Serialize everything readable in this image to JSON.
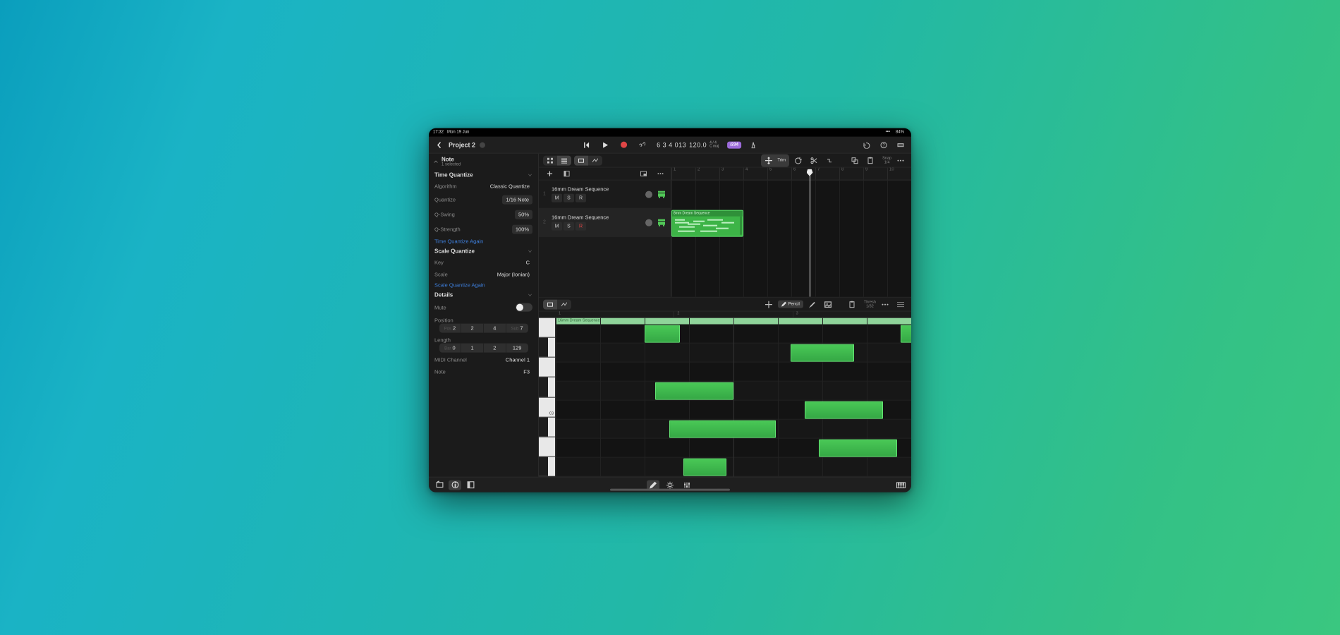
{
  "status": {
    "time": "17:32",
    "date": "Mon 19 Jun",
    "battery": "84%"
  },
  "nav": {
    "project_title": "Project 2",
    "lcd": {
      "position": "6 3 4 013",
      "tempo": "120.0",
      "sig": "4 / 4",
      "key": "C maj",
      "beat_badge": "/234"
    }
  },
  "inspector": {
    "header_title": "Note",
    "header_sub": "1 selected",
    "time_quantize_title": "Time Quantize",
    "algorithm_k": "Algorithm",
    "algorithm_v": "Classic Quantize",
    "quantize_k": "Quantize",
    "quantize_v": "1/16 Note",
    "qswing_k": "Q-Swing",
    "qswing_v": "50%",
    "qstrength_k": "Q-Strength",
    "qstrength_v": "100%",
    "tq_again": "Time Quantize Again",
    "scale_quantize_title": "Scale Quantize",
    "key_k": "Key",
    "key_v": "C",
    "scale_k": "Scale",
    "scale_v": "Major (Ionian)",
    "sq_again": "Scale Quantize Again",
    "details_title": "Details",
    "mute_k": "Mute",
    "position_k": "Position",
    "position_vals": [
      "2",
      "2",
      "4",
      "7"
    ],
    "length_k": "Length",
    "length_vals": [
      "0",
      "1",
      "2",
      "129"
    ],
    "midi_k": "MIDI Channel",
    "midi_v": "Channel 1",
    "note_k": "Note",
    "note_v": "F3"
  },
  "tracks_toolbar": {
    "trim": "Trim",
    "snap_label": "Snap",
    "snap_value": "1/4"
  },
  "tracks": [
    {
      "name": "16mm Dream Sequence",
      "m": "M",
      "s": "S",
      "r": "R"
    },
    {
      "name": "16mm Dream Sequence",
      "m": "M",
      "s": "S",
      "r": "R"
    }
  ],
  "region": {
    "title": "8mm Dream Sequence"
  },
  "ruler": [
    "1",
    "2",
    "3",
    "4",
    "5",
    "6",
    "7",
    "8",
    "9",
    "10"
  ],
  "piano": {
    "strip_name": "16mm Dream Sequence",
    "pencil": "Pencil",
    "thresh_label": "Thresh",
    "thresh_value": "1/32",
    "c_label": "C3",
    "ruler": [
      "1",
      "2",
      "3"
    ]
  }
}
